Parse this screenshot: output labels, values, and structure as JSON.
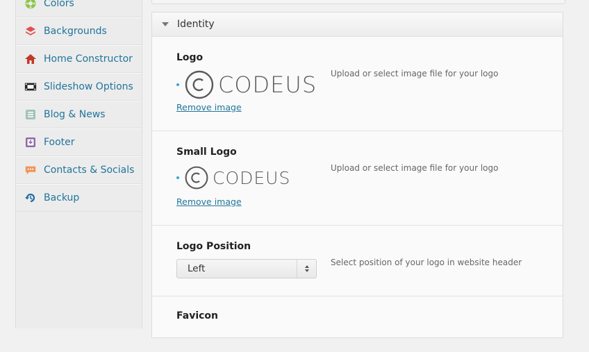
{
  "sidebar": {
    "items": [
      {
        "label": "Colors",
        "icon": "palette-icon"
      },
      {
        "label": "Backgrounds",
        "icon": "layers-icon"
      },
      {
        "label": "Home Constructor",
        "icon": "home-icon"
      },
      {
        "label": "Slideshow Options",
        "icon": "filmstrip-icon"
      },
      {
        "label": "Blog & News",
        "icon": "document-icon"
      },
      {
        "label": "Footer",
        "icon": "download-box-icon"
      },
      {
        "label": "Contacts & Socials",
        "icon": "chat-bubble-icon"
      },
      {
        "label": "Backup",
        "icon": "restore-icon"
      }
    ]
  },
  "panel": {
    "title": "Identity",
    "logo": {
      "label": "Logo",
      "image_text": "CODEUS",
      "remove_label": "Remove image",
      "description": "Upload or select image file for your logo"
    },
    "small_logo": {
      "label": "Small Logo",
      "image_text": "CODEUS",
      "remove_label": "Remove image",
      "description": "Upload or select image file for your logo"
    },
    "logo_position": {
      "label": "Logo Position",
      "selected": "Left",
      "description": "Select position of your logo in website header"
    },
    "favicon": {
      "label": "Favicon"
    }
  },
  "colors": {
    "link": "#21759b",
    "accent_dot": "#3aa3d8"
  }
}
